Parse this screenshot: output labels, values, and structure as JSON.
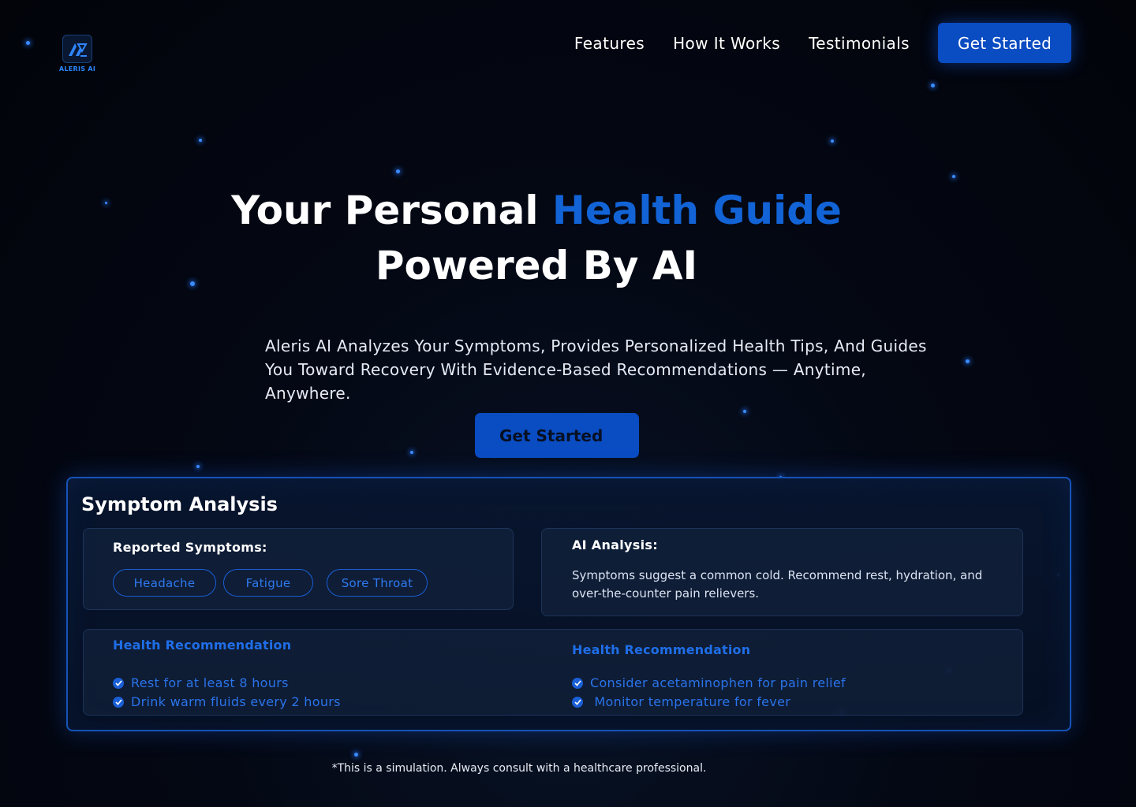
{
  "brand": {
    "name": "ALERIS AI",
    "logo_icon": "aleris-logo-icon",
    "accent_color": "#0a4cc2"
  },
  "nav": {
    "links": [
      "Features",
      "How It Works",
      "Testimonials"
    ],
    "cta_label": "Get Started"
  },
  "hero": {
    "title_part1": "Your Personal ",
    "title_highlight": "Health Guide",
    "title_line2": "Powered By AI",
    "description": "Aleris AI Analyzes Your Symptoms, Provides Personalized Health Tips, And Guides You Toward Recovery With Evidence-Based Recommendations — Anytime, Anywhere.",
    "cta_label": "Get Started"
  },
  "analysis": {
    "title": "Symptom Analysis",
    "reported_label": "Reported Symptoms:",
    "symptoms": [
      "Headache",
      "Fatigue",
      "Sore Throat"
    ],
    "ai_label": "AI Analysis:",
    "ai_text": "Symptoms suggest a common cold. Recommend rest, hydration, and over-the-counter pain relievers.",
    "recommendations": [
      {
        "heading": "Health Recommendation",
        "items": [
          "Rest for at least 8 hours",
          "Drink warm fluids every 2 hours"
        ]
      },
      {
        "heading": "Health Recommendation",
        "items": [
          "Consider acetaminophen for pain relief",
          " Monitor temperature for fever"
        ]
      }
    ]
  },
  "disclaimer": "*This is a simulation. Always consult with a healthcare professional."
}
